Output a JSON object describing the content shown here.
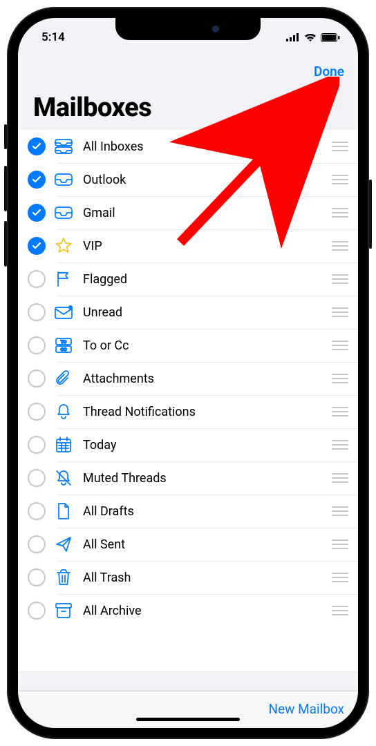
{
  "status": {
    "time": "5:14"
  },
  "nav": {
    "done": "Done"
  },
  "title": "Mailboxes",
  "footer": {
    "new_mailbox": "New Mailbox"
  },
  "rows": [
    {
      "id": "all-inboxes",
      "label": "All Inboxes",
      "checked": true,
      "icon": "all-inboxes"
    },
    {
      "id": "outlook",
      "label": "Outlook",
      "checked": true,
      "icon": "inbox"
    },
    {
      "id": "gmail",
      "label": "Gmail",
      "checked": true,
      "icon": "inbox"
    },
    {
      "id": "vip",
      "label": "VIP",
      "checked": true,
      "icon": "star"
    },
    {
      "id": "flagged",
      "label": "Flagged",
      "checked": false,
      "icon": "flag"
    },
    {
      "id": "unread",
      "label": "Unread",
      "checked": false,
      "icon": "unread"
    },
    {
      "id": "to-cc",
      "label": "To or Cc",
      "checked": false,
      "icon": "to-cc"
    },
    {
      "id": "attachments",
      "label": "Attachments",
      "checked": false,
      "icon": "paperclip"
    },
    {
      "id": "thread-notifications",
      "label": "Thread Notifications",
      "checked": false,
      "icon": "bell"
    },
    {
      "id": "today",
      "label": "Today",
      "checked": false,
      "icon": "calendar"
    },
    {
      "id": "muted",
      "label": "Muted Threads",
      "checked": false,
      "icon": "bell-slash"
    },
    {
      "id": "all-drafts",
      "label": "All Drafts",
      "checked": false,
      "icon": "doc"
    },
    {
      "id": "all-sent",
      "label": "All Sent",
      "checked": false,
      "icon": "paperplane"
    },
    {
      "id": "all-trash",
      "label": "All Trash",
      "checked": false,
      "icon": "trash"
    },
    {
      "id": "all-archive",
      "label": "All Archive",
      "checked": false,
      "icon": "archivebox"
    }
  ]
}
